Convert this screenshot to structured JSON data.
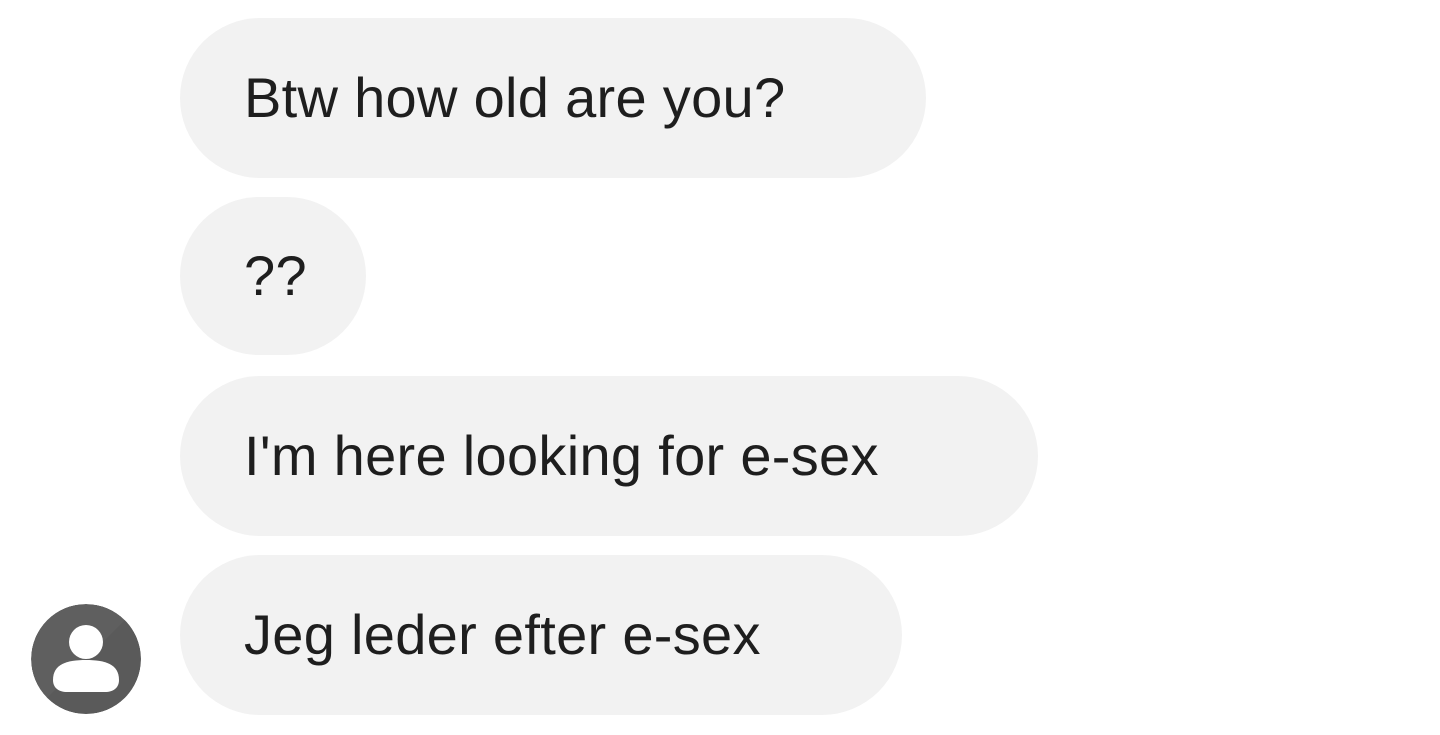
{
  "conversation": {
    "messages": [
      {
        "text": "Btw how old are you?"
      },
      {
        "text": "??"
      },
      {
        "text": "I'm here looking for e-sex"
      },
      {
        "text": "Jeg leder efter e-sex"
      }
    ],
    "sender_avatar": {
      "icon": "user-silhouette-icon",
      "color": "#5f5f5f"
    }
  },
  "colors": {
    "background": "#ffffff",
    "bubble": "#f2f2f2",
    "text": "#1e1e1e"
  }
}
